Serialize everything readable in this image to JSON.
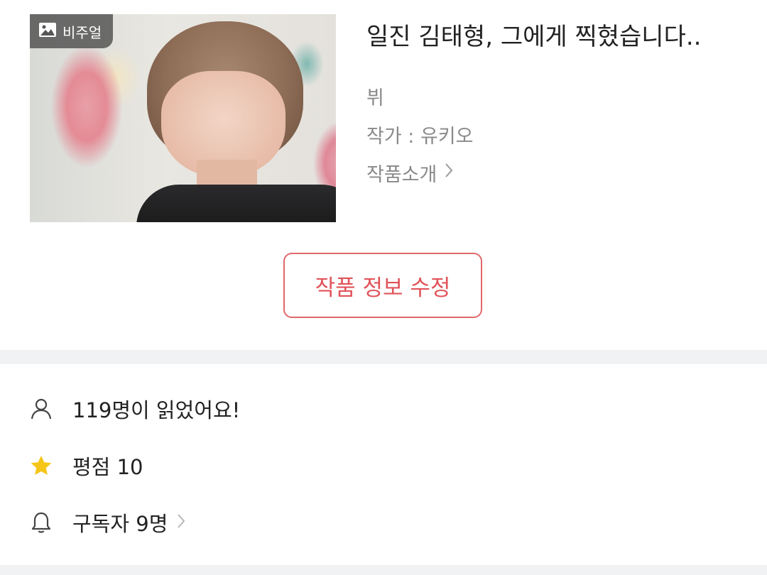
{
  "work": {
    "badge_label": "비주얼",
    "title": "일진 김태형, 그에게 찍혔습니다..",
    "tag": "뷔",
    "author": "작가 : 유키오",
    "intro_label": "작품소개",
    "intro_chevron": "›"
  },
  "actions": {
    "edit_label": "작품 정보 수정"
  },
  "stats": {
    "readers": "119명이 읽었어요!",
    "rating": "평점 10",
    "subscribers": "구독자 9명",
    "subscribers_chevron": "›"
  },
  "icons": {
    "badge": "image-icon",
    "readers": "person-icon",
    "rating": "star-icon",
    "subscribers": "bell-icon",
    "chevron": "chevron-right-icon"
  },
  "colors": {
    "accent": "#e0545a",
    "star": "#f5c518",
    "muted_text": "#8a8a8a",
    "divider": "#f1f2f4"
  }
}
